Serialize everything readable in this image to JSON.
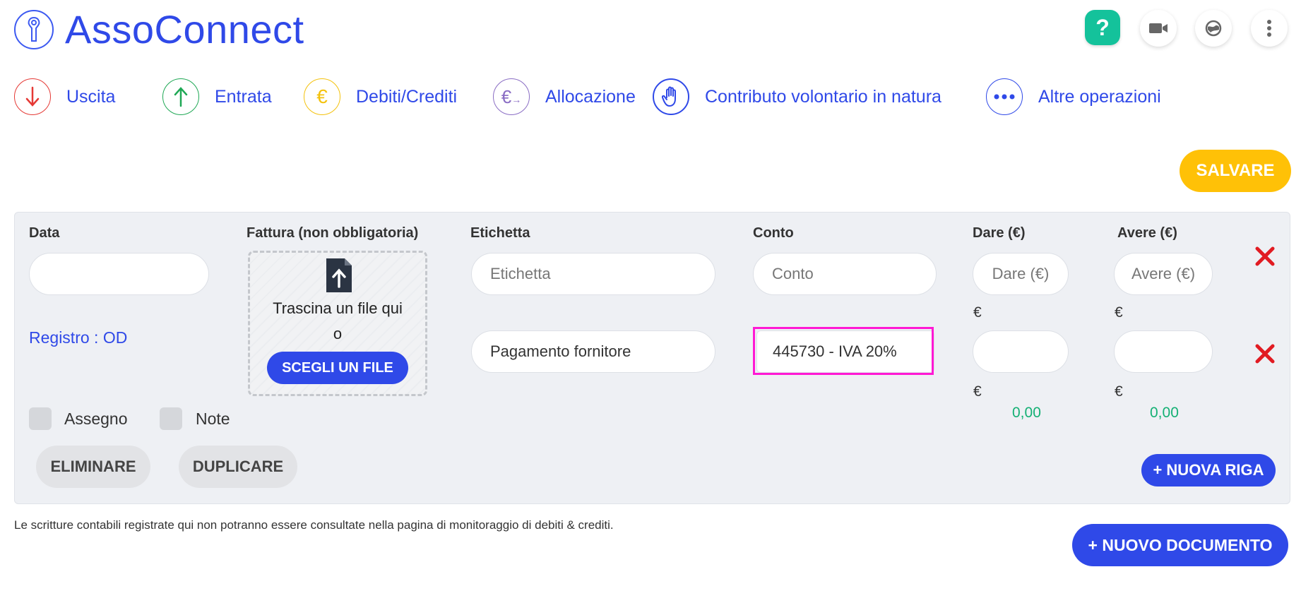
{
  "app": {
    "title": "AssoConnect"
  },
  "header": {
    "help_label": "?",
    "icons": [
      "help-icon",
      "video-icon",
      "language-icon",
      "more-vertical-icon"
    ]
  },
  "operations": [
    {
      "label": "Uscita",
      "icon": "arrow-down-icon",
      "color": "#e53935"
    },
    {
      "label": "Entrata",
      "icon": "arrow-up-icon",
      "color": "#1fa855"
    },
    {
      "label": "Debiti/Crediti",
      "icon": "euro-icon",
      "color": "#f4c20d"
    },
    {
      "label": "Allocazione",
      "icon": "euro-transfer-icon",
      "color": "#8a6dc4"
    },
    {
      "label": "Contributo volontario in natura",
      "icon": "hand-icon",
      "color": "#2f49e8"
    },
    {
      "label": "Altre operazioni",
      "icon": "dots-icon",
      "color": "#2f49e8"
    }
  ],
  "toolbar": {
    "save_label": "SALVARE"
  },
  "entry": {
    "labels": {
      "data": "Data",
      "fattura": "Fattura (non obbligatoria)",
      "etichetta": "Etichetta",
      "conto": "Conto",
      "dare": "Dare (€)",
      "avere": "Avere (€)"
    },
    "date_value": "",
    "dropzone": {
      "text": "Trascina un file qui",
      "or": "o",
      "button": "SCEGLI UN FILE"
    },
    "registro": "Registro : OD",
    "rows": [
      {
        "etichetta_placeholder": "Etichetta",
        "etichetta_value": "",
        "conto_placeholder": "Conto",
        "conto_value": "",
        "dare_placeholder": "Dare (€)",
        "avere_placeholder": "Avere (€)"
      },
      {
        "etichetta_value": "Pagamento fornitore",
        "conto_value": "445730 - IVA 20%",
        "dare_value": "",
        "avere_value": ""
      }
    ],
    "currency_symbol": "€",
    "totals": {
      "dare": "0,00",
      "avere": "0,00"
    },
    "checkboxes": {
      "assegno": "Assegno",
      "note": "Note"
    },
    "buttons": {
      "eliminare": "ELIMINARE",
      "duplicare": "DUPLICARE",
      "nuova_riga": "+ NUOVA RIGA"
    }
  },
  "footnote": "Le scritture contabili registrate qui non potranno essere consultate nella pagina di monitoraggio di debiti & crediti.",
  "footer": {
    "new_document": "+ NUOVO DOCUMENTO"
  },
  "colors": {
    "primary": "#2f49e8",
    "save": "#ffc107",
    "help": "#14c29b",
    "delete": "#e11b22",
    "amount": "#14b074",
    "highlight": "#ff19d4"
  }
}
